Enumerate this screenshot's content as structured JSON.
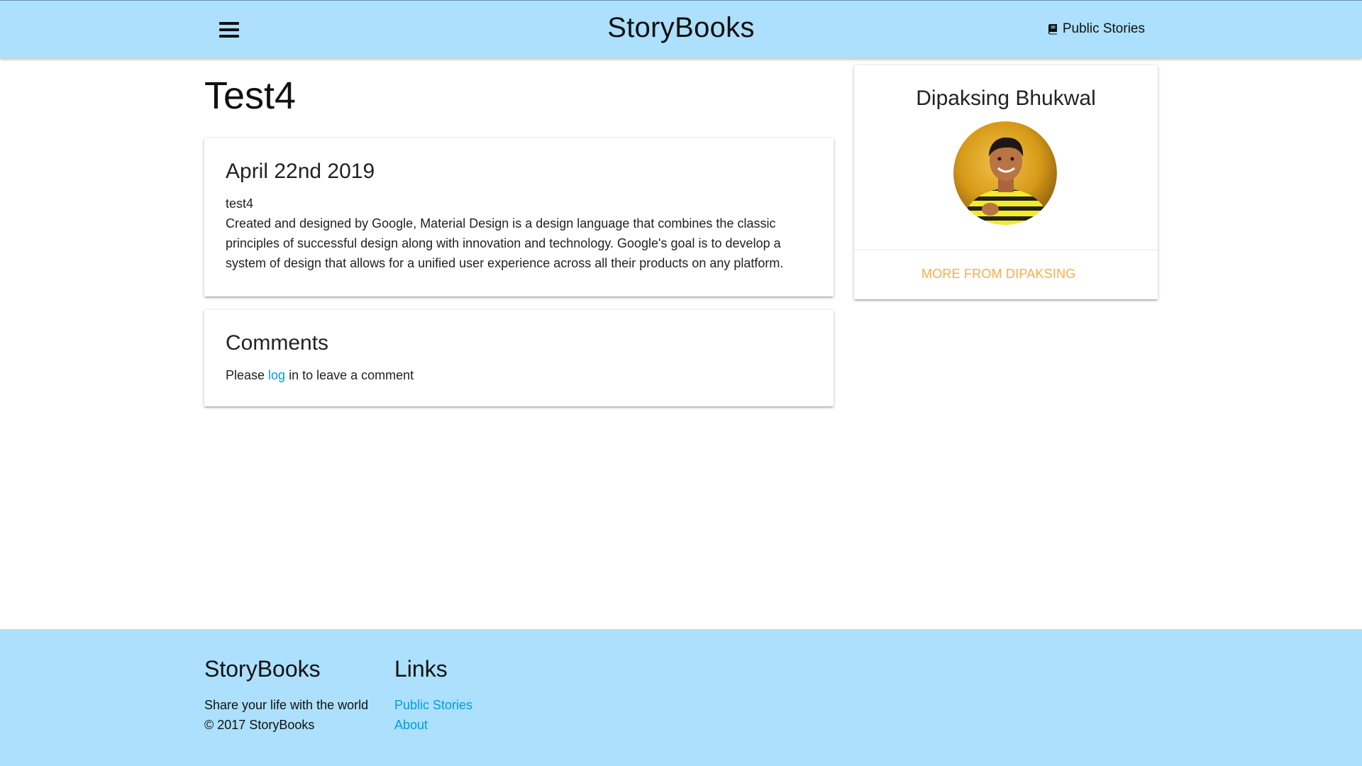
{
  "navbar": {
    "brand": "StoryBooks",
    "menu_icon": "hamburger-menu-icon",
    "public_stories_label": "Public Stories",
    "public_stories_icon": "book-icon",
    "background_color": "#ace0fc"
  },
  "story": {
    "title": "Test4",
    "date": "April 22nd 2019",
    "subtitle": "test4",
    "body": "Created and designed by Google, Material Design is a design language that combines the classic principles of successful design along with innovation and technology. Google's goal is to develop a system of design that allows for a unified user experience across all their products on any platform."
  },
  "comments": {
    "heading": "Comments",
    "prefix": "Please ",
    "link_text": "log",
    "suffix": " in to leave a comment",
    "link_color": "#039be5"
  },
  "author": {
    "name": "Dipaksing Bhukwal",
    "avatar_icon": "avatar-photo",
    "more_label": "More From Dipaksing",
    "more_color": "#ffab40"
  },
  "footer": {
    "brand_heading": "StoryBooks",
    "tagline": "Share your life with the world",
    "copyright": "© 2017 StoryBooks",
    "links_heading": "Links",
    "links": [
      {
        "label": "Public Stories"
      },
      {
        "label": "About"
      }
    ],
    "background_color": "#ace0fc"
  }
}
